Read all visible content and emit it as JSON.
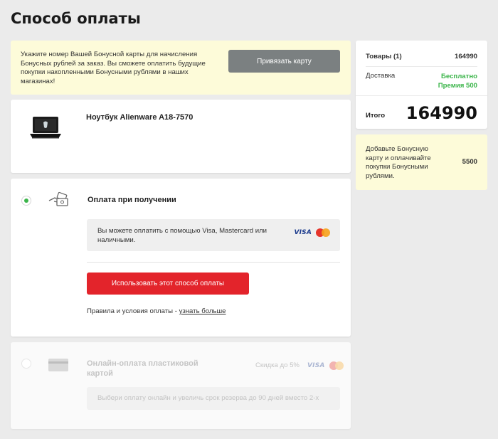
{
  "page": {
    "title": "Способ оплаты"
  },
  "bonus_notice": {
    "text": "Укажите номер Вашей Бонусной карты для начисления Бонусных рублей за заказ. Вы сможете оплатить будущие покупки накопленными Бонусными рублями в наших магазинах!",
    "button_label": "Привязать карту"
  },
  "product": {
    "name": "Ноутбук Alienware A18-7570",
    "image_icon": "laptop-icon"
  },
  "payment_cash": {
    "title": "Оплата при получении",
    "selected": true,
    "info_text": "Вы можете оплатить с помощью Visa, Mastercard или наличными.",
    "visa_label": "VISA",
    "use_button_label": "Использовать этот способ оплаты",
    "rules_text": "Правила и условия оплаты - ",
    "rules_link": "узнать больше",
    "icon": "cash-hand-icon"
  },
  "payment_online": {
    "title": "Онлайн-оплата пластиковой картой",
    "selected": false,
    "discount_text": "Скидка до 5%",
    "visa_label": "VISA",
    "info_text": "Выбери оплату онлайн и увеличь срок резерва до 90 дней вместо 2-х",
    "icon": "credit-card-icon"
  },
  "summary": {
    "items_label": "Товары (1)",
    "items_value": "164990",
    "delivery_label": "Доставка",
    "delivery_value_line1": "Бесплатно",
    "delivery_value_line2": "Премия 500",
    "total_label": "Итого",
    "total_value": "164990"
  },
  "bonus_side": {
    "text": "Добавьте Бонусную карту и оплачивайте покупки Бонусными рублями.",
    "value": "5500"
  },
  "colors": {
    "accent_red": "#e3242b",
    "success_green": "#3bb54a",
    "notice_yellow": "#fdfbd9",
    "button_gray": "#7b8081"
  }
}
